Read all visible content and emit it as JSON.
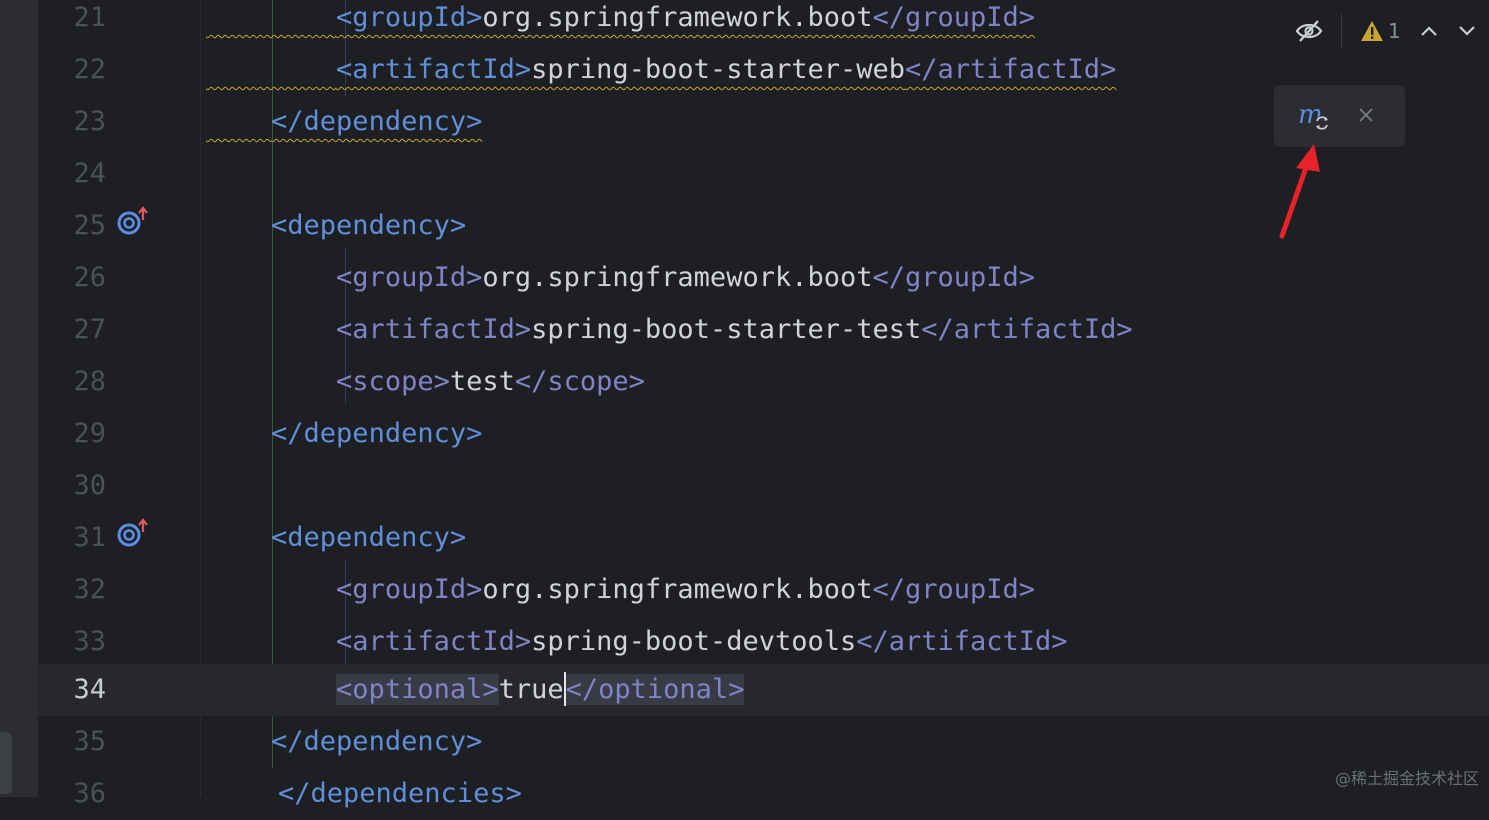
{
  "editor": {
    "lines": [
      {
        "num": "21",
        "indent": "        ",
        "open": "<groupId>",
        "text": "org.springframework.boot",
        "close": "</groupId>"
      },
      {
        "num": "22",
        "indent": "        ",
        "open": "<artifactId>",
        "text": "spring-boot-starter-web",
        "close": "</artifactId>"
      },
      {
        "num": "23",
        "indent": "    ",
        "close": "</dependency>"
      },
      {
        "num": "24"
      },
      {
        "num": "25",
        "indent": "    ",
        "open": "<dependency>"
      },
      {
        "num": "26",
        "indent": "        ",
        "open": "<groupId>",
        "text": "org.springframework.boot",
        "close": "</groupId>"
      },
      {
        "num": "27",
        "indent": "        ",
        "open": "<artifactId>",
        "text": "spring-boot-starter-test",
        "close": "</artifactId>"
      },
      {
        "num": "28",
        "indent": "        ",
        "open": "<scope>",
        "text": "test",
        "close": "</scope>"
      },
      {
        "num": "29",
        "indent": "    ",
        "close": "</dependency>"
      },
      {
        "num": "30"
      },
      {
        "num": "31",
        "indent": "    ",
        "open": "<dependency>"
      },
      {
        "num": "32",
        "indent": "        ",
        "open": "<groupId>",
        "text": "org.springframework.boot",
        "close": "</groupId>"
      },
      {
        "num": "33",
        "indent": "        ",
        "open": "<artifactId>",
        "text": "spring-boot-devtools",
        "close": "</artifactId>"
      },
      {
        "num": "34",
        "indent": "        ",
        "open": "<optional>",
        "text": "true",
        "close": "</optional>"
      },
      {
        "num": "35",
        "indent": "    ",
        "close": "</dependency>"
      },
      {
        "num": "36",
        "close": "</dependencies>"
      }
    ],
    "current_line": "34"
  },
  "inspection": {
    "hide_icon": "eye-slash-icon",
    "warning_icon": "warning-triangle-icon",
    "warning_count": "1",
    "prev_icon": "chevron-up-icon",
    "next_icon": "chevron-down-icon"
  },
  "maven_popup": {
    "reload_icon": "maven-reload-icon",
    "close_icon": "close-icon"
  },
  "watermark": "@稀土掘金技术社区",
  "colors": {
    "background": "#1e1f22",
    "tag": "#5f8fd9",
    "tag_secondary": "#7f83c8",
    "text": "#d0d3d8",
    "warning": "#c9a432",
    "arrow": "#e8222b"
  }
}
